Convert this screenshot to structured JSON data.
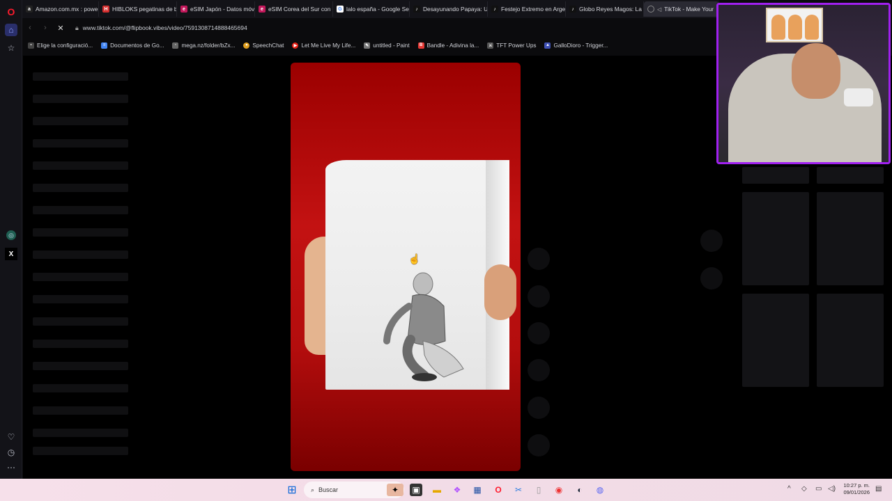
{
  "tabs": [
    {
      "label": "Amazon.com.mx : power i",
      "icon": "amazon-icon",
      "color": "#222222"
    },
    {
      "label": "HIBLOKS pegatinas de bl",
      "icon": "shop-icon",
      "color": "#d32f2f"
    },
    {
      "label": "eSIM Japón - Datos móvil",
      "icon": "esim-icon",
      "color": "#c2185b"
    },
    {
      "label": "eSIM Corea del Sur con d",
      "icon": "esim-icon",
      "color": "#c2185b"
    },
    {
      "label": "lalo españa - Google Sear",
      "icon": "google-icon",
      "color": "#ffffff"
    },
    {
      "label": "Desayunando Papaya: Un",
      "icon": "tiktok-icon",
      "color": "#111111"
    },
    {
      "label": "Festejo Extremo en Argen",
      "icon": "tiktok-icon",
      "color": "#111111"
    },
    {
      "label": "Globo Reyes Magos: La Se",
      "icon": "tiktok-icon",
      "color": "#111111"
    },
    {
      "label": "TikTok - Make Your",
      "icon": "tiktok-icon",
      "color": "#111111",
      "active": true
    }
  ],
  "address": {
    "url": "www.tiktok.com/@flipbook.vibes/video/7591308714888465694"
  },
  "bookmarks": [
    {
      "label": "Elige la configuració...",
      "icon": "bookmark-icon",
      "color": "#444"
    },
    {
      "label": "Documentos de Go...",
      "icon": "docs-icon",
      "color": "#4285f4"
    },
    {
      "label": "mega.nz/folder/bZx...",
      "icon": "page-icon",
      "color": "#666"
    },
    {
      "label": "SpeechChat",
      "icon": "speechchat-icon",
      "color": "#e0a020"
    },
    {
      "label": "Let Me Live My Life...",
      "icon": "youtube-icon",
      "color": "#e62117"
    },
    {
      "label": "untitled - Paint",
      "icon": "paint-icon",
      "color": "#777"
    },
    {
      "label": "Bandle - Adivina la...",
      "icon": "bandle-icon",
      "color": "#e53935"
    },
    {
      "label": "TFT Power Ups",
      "icon": "tft-icon",
      "color": "#555"
    },
    {
      "label": "GalloDioro - Trigger...",
      "icon": "twitch-icon",
      "color": "#3f51b5"
    }
  ],
  "taskbar": {
    "search_label": "Buscar",
    "time": "10:27 p. m.",
    "date": "09/01/2026"
  },
  "colors": {
    "accent": "#a020f0",
    "video_bg": "#c31212",
    "opera": "#ff1b2d"
  }
}
